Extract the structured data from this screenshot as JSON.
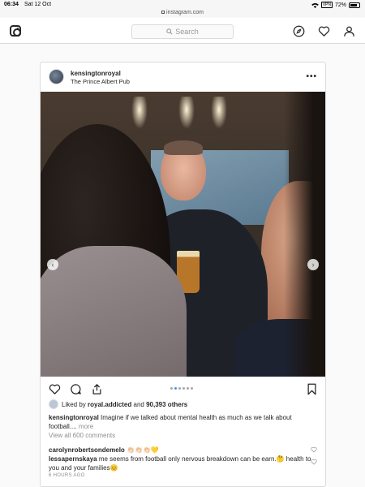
{
  "status_bar": {
    "time": "06:34",
    "date": "Sat 12 Oct",
    "battery": "72%",
    "battery_level": 0.72,
    "vpn": "VPN"
  },
  "url_bar": {
    "url": "instagram.com"
  },
  "nav": {
    "search_placeholder": "Search",
    "icons": [
      "instagram-logo-icon",
      "compass-icon",
      "heart-icon",
      "profile-icon"
    ]
  },
  "post": {
    "username": "kensingtonroyal",
    "location": "The Prince Albert Pub",
    "more": "•••",
    "carousel": {
      "count": 6,
      "active": 1
    },
    "likes": {
      "prefix": "Liked by",
      "user": "royal.addicted",
      "connector": "and",
      "others": "90,393 others"
    },
    "caption": {
      "username": "kensingtonroyal",
      "text": " Imagine if we talked about mental health as much as we talk about football....",
      "more": " more"
    },
    "view_all": "View all 600 comments",
    "comments": [
      {
        "username": "carolynrobertsondemelo",
        "text": " 👏🏻👏🏻👏🏻💛"
      },
      {
        "username": "lessapernskaya",
        "text": " me seems from football only nervous breakdown can be earn.🤔 health to you and your families😊"
      }
    ],
    "timestamp": "6 HOURS AGO"
  },
  "colors": {
    "link_blue": "#3897f0",
    "border": "#dbdbdb",
    "muted": "#8e8e8e"
  }
}
